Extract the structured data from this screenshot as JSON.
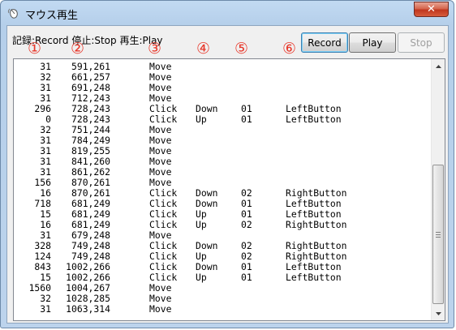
{
  "window": {
    "title": "マウス再生",
    "close_label": "✕"
  },
  "toolbar": {
    "legend": "記録:Record 停止:Stop 再生:Play",
    "record_label": "Record",
    "play_label": "Play",
    "stop_label": "Stop"
  },
  "annotations": [
    "①",
    "②",
    "③",
    "④",
    "⑤",
    "⑥"
  ],
  "rows": [
    {
      "interval": "31",
      "pos": "591,261",
      "action": "Move",
      "state": "",
      "code": "",
      "button": ""
    },
    {
      "interval": "32",
      "pos": "661,257",
      "action": "Move",
      "state": "",
      "code": "",
      "button": ""
    },
    {
      "interval": "31",
      "pos": "691,248",
      "action": "Move",
      "state": "",
      "code": "",
      "button": ""
    },
    {
      "interval": "31",
      "pos": "712,243",
      "action": "Move",
      "state": "",
      "code": "",
      "button": ""
    },
    {
      "interval": "296",
      "pos": "728,243",
      "action": "Click",
      "state": "Down",
      "code": "01",
      "button": "LeftButton"
    },
    {
      "interval": "0",
      "pos": "728,243",
      "action": "Click",
      "state": "Up",
      "code": "01",
      "button": "LeftButton"
    },
    {
      "interval": "32",
      "pos": "751,244",
      "action": "Move",
      "state": "",
      "code": "",
      "button": ""
    },
    {
      "interval": "31",
      "pos": "784,249",
      "action": "Move",
      "state": "",
      "code": "",
      "button": ""
    },
    {
      "interval": "31",
      "pos": "819,255",
      "action": "Move",
      "state": "",
      "code": "",
      "button": ""
    },
    {
      "interval": "31",
      "pos": "841,260",
      "action": "Move",
      "state": "",
      "code": "",
      "button": ""
    },
    {
      "interval": "31",
      "pos": "861,262",
      "action": "Move",
      "state": "",
      "code": "",
      "button": ""
    },
    {
      "interval": "156",
      "pos": "870,261",
      "action": "Move",
      "state": "",
      "code": "",
      "button": ""
    },
    {
      "interval": "16",
      "pos": "870,261",
      "action": "Click",
      "state": "Down",
      "code": "02",
      "button": "RightButton"
    },
    {
      "interval": "718",
      "pos": "681,249",
      "action": "Click",
      "state": "Down",
      "code": "01",
      "button": "LeftButton"
    },
    {
      "interval": "15",
      "pos": "681,249",
      "action": "Click",
      "state": "Up",
      "code": "01",
      "button": "LeftButton"
    },
    {
      "interval": "16",
      "pos": "681,249",
      "action": "Click",
      "state": "Up",
      "code": "02",
      "button": "RightButton"
    },
    {
      "interval": "31",
      "pos": "679,248",
      "action": "Move",
      "state": "",
      "code": "",
      "button": ""
    },
    {
      "interval": "328",
      "pos": "749,248",
      "action": "Click",
      "state": "Down",
      "code": "02",
      "button": "RightButton"
    },
    {
      "interval": "124",
      "pos": "749,248",
      "action": "Click",
      "state": "Up",
      "code": "02",
      "button": "RightButton"
    },
    {
      "interval": "843",
      "pos": "1002,266",
      "action": "Click",
      "state": "Down",
      "code": "01",
      "button": "LeftButton"
    },
    {
      "interval": "15",
      "pos": "1002,266",
      "action": "Click",
      "state": "Up",
      "code": "01",
      "button": "LeftButton"
    },
    {
      "interval": "1560",
      "pos": "1004,267",
      "action": "Move",
      "state": "",
      "code": "",
      "button": ""
    },
    {
      "interval": "32",
      "pos": "1028,285",
      "action": "Move",
      "state": "",
      "code": "",
      "button": ""
    },
    {
      "interval": "31",
      "pos": "1063,314",
      "action": "Move",
      "state": "",
      "code": "",
      "button": ""
    }
  ],
  "icons": {
    "app": "mouse-icon",
    "close": "close-icon",
    "scroll_up": "chevron-up-icon",
    "scroll_down": "chevron-down-icon"
  },
  "colors": {
    "annotation": "#e8372a",
    "close_button": "#c0361d"
  }
}
